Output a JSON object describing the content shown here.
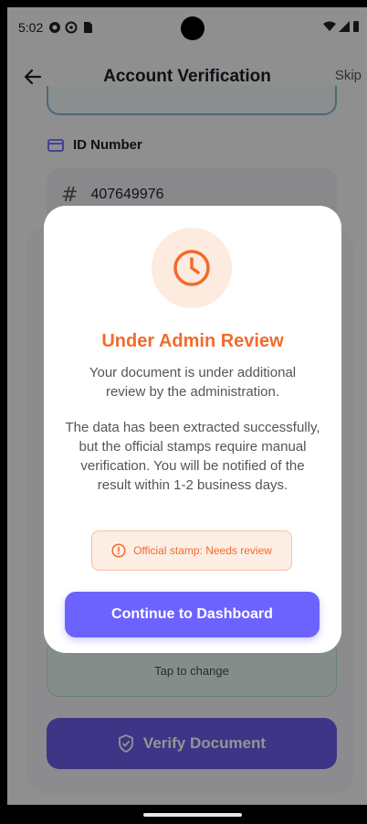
{
  "status_bar": {
    "time": "5:02"
  },
  "header": {
    "title": "Account Verification",
    "skip_label": "Skip"
  },
  "form": {
    "id_label": "ID Number",
    "id_value": "407649976",
    "upload_hint": "Tap to change",
    "verify_label": "Verify Document"
  },
  "modal": {
    "title": "Under Admin Review",
    "paragraph1": "Your document is under additional review by the administration.",
    "paragraph2": "The data has been extracted successfully, but the official stamps require manual verification. You will be notified of the result within 1-2 business days.",
    "stamp_status": "Official stamp: Needs review",
    "continue_label": "Continue to Dashboard"
  },
  "colors": {
    "accent": "#6c63ff",
    "warning": "#f26b2b",
    "warning_bg": "#fdebe0"
  }
}
